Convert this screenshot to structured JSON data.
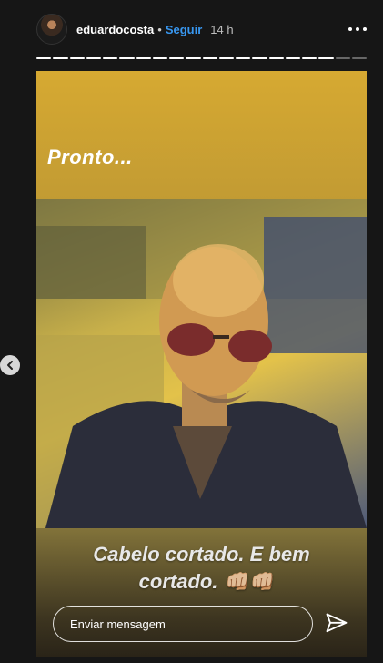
{
  "header": {
    "username": "eduardocosta",
    "separator": "•",
    "follow_label": "Seguir",
    "time": "14 h"
  },
  "progress": {
    "segments_total": 20,
    "segments_viewed": 18
  },
  "story": {
    "top_text": "Pronto...",
    "caption_line1": "Cabelo cortado. E bem",
    "caption_line2": "cortado. 👊🏼👊🏼"
  },
  "reply": {
    "placeholder": "Enviar mensagem"
  },
  "colors": {
    "background": "#161616",
    "follow_link": "#3897f0",
    "story_top_band": "#d6a932"
  },
  "icons": {
    "more": "more-horizontal-icon",
    "send": "paper-plane-icon",
    "previous": "chevron-left-icon"
  }
}
